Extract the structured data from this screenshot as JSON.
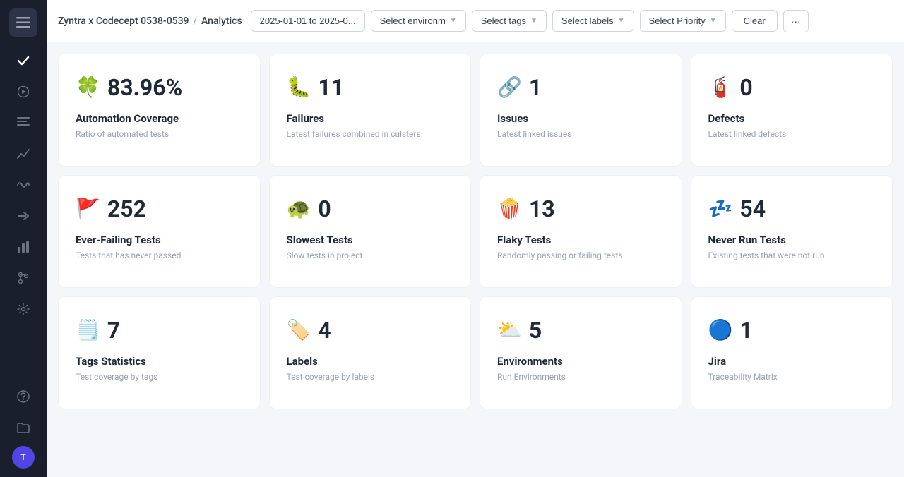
{
  "sidebar": {
    "logo_icon": "☰",
    "items": [
      {
        "name": "checkmark",
        "icon": "✓",
        "active": true
      },
      {
        "name": "play",
        "icon": "▶",
        "active": false
      },
      {
        "name": "list",
        "icon": "≡",
        "active": false
      },
      {
        "name": "trend",
        "icon": "↗",
        "active": false
      },
      {
        "name": "wave",
        "icon": "∿",
        "active": false
      },
      {
        "name": "arrow-right",
        "icon": "→",
        "active": false
      },
      {
        "name": "bar-chart",
        "icon": "▦",
        "active": false
      },
      {
        "name": "git",
        "icon": "⎇",
        "active": false
      },
      {
        "name": "settings",
        "icon": "⚙",
        "active": false
      },
      {
        "name": "help",
        "icon": "?",
        "active": false
      },
      {
        "name": "folder",
        "icon": "▤",
        "active": false
      }
    ],
    "avatar_text": "T"
  },
  "header": {
    "project_name": "Zyntra x Codecept 0538-0539",
    "separator": "/",
    "page_title": "Analytics",
    "date_filter": "2025-01-01 to 2025-0...",
    "env_filter": "Select environm",
    "tags_filter": "Select tags",
    "labels_filter": "Select labels",
    "priority_filter": "Select Priority",
    "clear_btn": "Clear",
    "more_btn": "···"
  },
  "cards": [
    {
      "icon": "🍀",
      "value": "83.96%",
      "title": "Automation Coverage",
      "subtitle": "Ratio of automated tests"
    },
    {
      "icon": "🐛",
      "value": "11",
      "title": "Failures",
      "subtitle": "Latest failures combined in culsters"
    },
    {
      "icon": "🔗",
      "value": "1",
      "title": "Issues",
      "subtitle": "Latest linked issues"
    },
    {
      "icon": "🧯",
      "value": "0",
      "title": "Defects",
      "subtitle": "Latest linked defects"
    },
    {
      "icon": "🚩",
      "value": "252",
      "title": "Ever-Failing Tests",
      "subtitle": "Tests that has never passed"
    },
    {
      "icon": "🐢",
      "value": "0",
      "title": "Slowest Tests",
      "subtitle": "Slow tests in project"
    },
    {
      "icon": "🍿",
      "value": "13",
      "title": "Flaky Tests",
      "subtitle": "Randomly passing or failing tests"
    },
    {
      "icon": "💤",
      "value": "54",
      "title": "Never Run Tests",
      "subtitle": "Existing tests that were not run"
    },
    {
      "icon": "🗒️",
      "value": "7",
      "title": "Tags Statistics",
      "subtitle": "Test coverage by tags"
    },
    {
      "icon": "🏷️",
      "value": "4",
      "title": "Labels",
      "subtitle": "Test coverage by labels"
    },
    {
      "icon": "⛅",
      "value": "5",
      "title": "Environments",
      "subtitle": "Run Environments"
    },
    {
      "icon": "🔵",
      "value": "1",
      "title": "Jira",
      "subtitle": "Traceability Matrix"
    }
  ]
}
